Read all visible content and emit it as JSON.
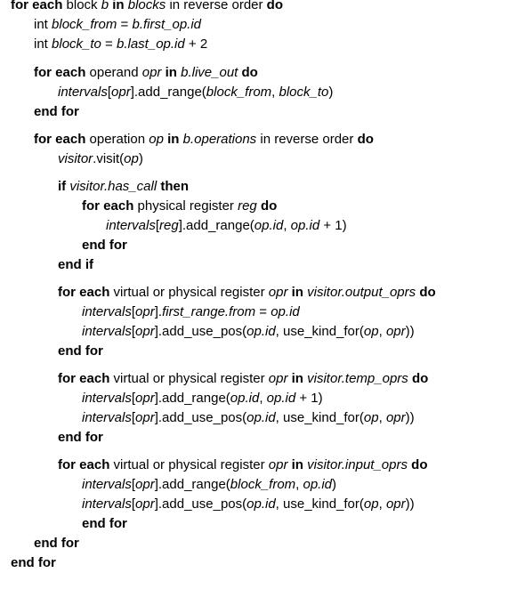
{
  "document": {
    "kind": "pseudocode",
    "lines": [
      [
        [
          "for each",
          "b"
        ],
        [
          " block ",
          ""
        ],
        [
          "b",
          "i"
        ],
        [
          " ",
          ""
        ],
        [
          "in",
          "b"
        ],
        [
          " ",
          ""
        ],
        [
          "blocks",
          "i"
        ],
        [
          " in reverse order ",
          ""
        ],
        [
          "do",
          "b"
        ]
      ],
      [
        [
          "int ",
          ""
        ],
        [
          "block_from",
          "i"
        ],
        [
          " = ",
          ""
        ],
        [
          "b.first_op.id",
          "i"
        ]
      ],
      [
        [
          "int ",
          ""
        ],
        [
          "block_to",
          "i"
        ],
        [
          " = ",
          ""
        ],
        [
          "b.last_op.id",
          "i"
        ],
        [
          " + 2",
          ""
        ]
      ],
      [
        [
          "for each",
          "b"
        ],
        [
          " operand ",
          ""
        ],
        [
          "opr",
          "i"
        ],
        [
          " ",
          ""
        ],
        [
          "in",
          "b"
        ],
        [
          " ",
          ""
        ],
        [
          "b.live_out",
          "i"
        ],
        [
          " ",
          ""
        ],
        [
          "do",
          "b"
        ]
      ],
      [
        [
          "intervals",
          "i"
        ],
        [
          "[",
          ""
        ],
        [
          "opr",
          "i"
        ],
        [
          "].add_range(",
          ""
        ],
        [
          "block_from",
          "i"
        ],
        [
          ", ",
          ""
        ],
        [
          "block_to",
          "i"
        ],
        [
          ")",
          ""
        ]
      ],
      [
        [
          "end for",
          "b"
        ]
      ],
      [
        [
          "for each",
          "b"
        ],
        [
          " operation ",
          ""
        ],
        [
          "op",
          "i"
        ],
        [
          " ",
          ""
        ],
        [
          "in",
          "b"
        ],
        [
          " ",
          ""
        ],
        [
          "b.operations",
          "i"
        ],
        [
          " in reverse order ",
          ""
        ],
        [
          "do",
          "b"
        ]
      ],
      [
        [
          "visitor",
          "i"
        ],
        [
          ".visit(",
          ""
        ],
        [
          "op",
          "i"
        ],
        [
          ")",
          ""
        ]
      ],
      [
        [
          "if",
          "b"
        ],
        [
          " ",
          ""
        ],
        [
          "visitor.has_call",
          "i"
        ],
        [
          " ",
          ""
        ],
        [
          "then",
          "b"
        ]
      ],
      [
        [
          "for each",
          "b"
        ],
        [
          " physical register ",
          ""
        ],
        [
          "reg",
          "i"
        ],
        [
          " ",
          ""
        ],
        [
          "do",
          "b"
        ]
      ],
      [
        [
          "intervals",
          "i"
        ],
        [
          "[",
          ""
        ],
        [
          "reg",
          "i"
        ],
        [
          "].add_range(",
          ""
        ],
        [
          "op.id",
          "i"
        ],
        [
          ", ",
          ""
        ],
        [
          "op.id",
          "i"
        ],
        [
          " + 1)",
          ""
        ]
      ],
      [
        [
          "end for",
          "b"
        ]
      ],
      [
        [
          "end if",
          "b"
        ]
      ],
      [
        [
          "for each",
          "b"
        ],
        [
          " virtual or physical register ",
          ""
        ],
        [
          "opr",
          "i"
        ],
        [
          " ",
          ""
        ],
        [
          "in",
          "b"
        ],
        [
          " ",
          ""
        ],
        [
          "visitor.output_oprs",
          "i"
        ],
        [
          " ",
          ""
        ],
        [
          "do",
          "b"
        ]
      ],
      [
        [
          "intervals",
          "i"
        ],
        [
          "[",
          ""
        ],
        [
          "opr",
          "i"
        ],
        [
          "].",
          ""
        ],
        [
          "first_range.from",
          "i"
        ],
        [
          " = ",
          ""
        ],
        [
          "op.id",
          "i"
        ]
      ],
      [
        [
          "intervals",
          "i"
        ],
        [
          "[",
          ""
        ],
        [
          "opr",
          "i"
        ],
        [
          "].add_use_pos(",
          ""
        ],
        [
          "op.id",
          "i"
        ],
        [
          ", use_kind_for(",
          ""
        ],
        [
          "op",
          "i"
        ],
        [
          ", ",
          ""
        ],
        [
          "opr",
          "i"
        ],
        [
          "))",
          ""
        ]
      ],
      [
        [
          "end for",
          "b"
        ]
      ],
      [
        [
          "for each",
          "b"
        ],
        [
          " virtual or physical register ",
          ""
        ],
        [
          "opr",
          "i"
        ],
        [
          " ",
          ""
        ],
        [
          "in",
          "b"
        ],
        [
          " ",
          ""
        ],
        [
          "visitor.temp_oprs",
          "i"
        ],
        [
          " ",
          ""
        ],
        [
          "do",
          "b"
        ]
      ],
      [
        [
          "intervals",
          "i"
        ],
        [
          "[",
          ""
        ],
        [
          "opr",
          "i"
        ],
        [
          "].add_range(",
          ""
        ],
        [
          "op.id",
          "i"
        ],
        [
          ", ",
          ""
        ],
        [
          "op.id",
          "i"
        ],
        [
          " + 1)",
          ""
        ]
      ],
      [
        [
          "intervals",
          "i"
        ],
        [
          "[",
          ""
        ],
        [
          "opr",
          "i"
        ],
        [
          "].add_use_pos(",
          ""
        ],
        [
          "op.id",
          "i"
        ],
        [
          ", use_kind_for(",
          ""
        ],
        [
          "op",
          "i"
        ],
        [
          ", ",
          ""
        ],
        [
          "opr",
          "i"
        ],
        [
          "))",
          ""
        ]
      ],
      [
        [
          "end for",
          "b"
        ]
      ],
      [
        [
          "for each",
          "b"
        ],
        [
          " virtual or physical register ",
          ""
        ],
        [
          "opr",
          "i"
        ],
        [
          " ",
          ""
        ],
        [
          "in",
          "b"
        ],
        [
          " ",
          ""
        ],
        [
          "visitor.input_oprs",
          "i"
        ],
        [
          " ",
          ""
        ],
        [
          "do",
          "b"
        ]
      ],
      [
        [
          "intervals",
          "i"
        ],
        [
          "[",
          ""
        ],
        [
          "opr",
          "i"
        ],
        [
          "].add_range(",
          ""
        ],
        [
          "block_from",
          "i"
        ],
        [
          ", ",
          ""
        ],
        [
          "op.id",
          "i"
        ],
        [
          ")",
          ""
        ]
      ],
      [
        [
          "intervals",
          "i"
        ],
        [
          "[",
          ""
        ],
        [
          "opr",
          "i"
        ],
        [
          "].add_use_pos(",
          ""
        ],
        [
          "op.id",
          "i"
        ],
        [
          ", use_kind_for(",
          ""
        ],
        [
          "op",
          "i"
        ],
        [
          ", ",
          ""
        ],
        [
          "opr",
          "i"
        ],
        [
          "))",
          ""
        ]
      ],
      [
        [
          "end for",
          "b"
        ]
      ],
      [
        [
          "end for",
          "b"
        ]
      ],
      [
        [
          "end for",
          "b"
        ]
      ]
    ]
  }
}
